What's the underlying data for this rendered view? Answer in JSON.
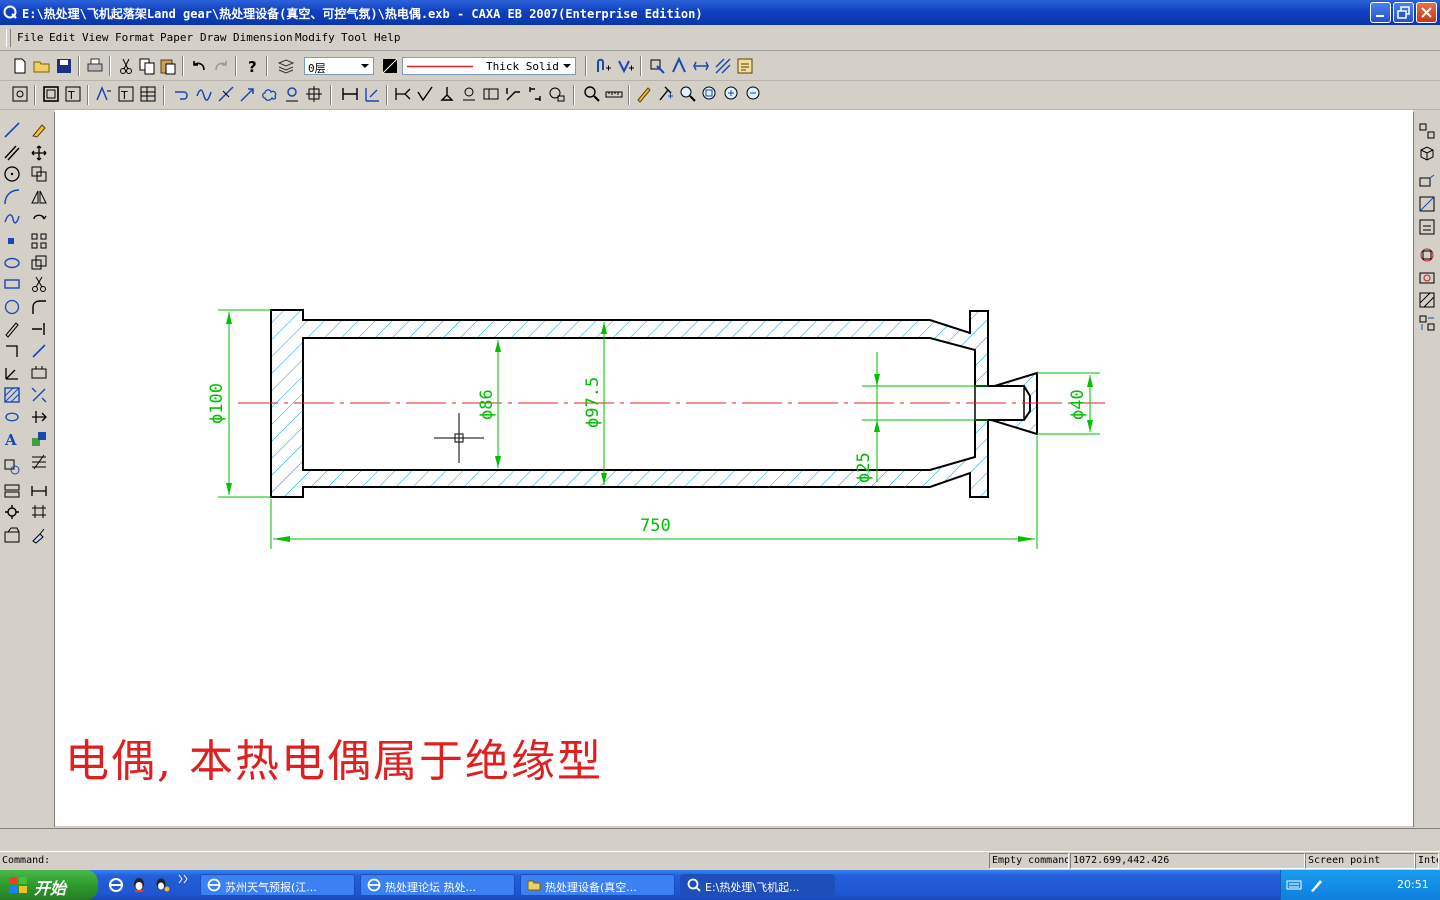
{
  "window": {
    "title": "E:\\热处理\\飞机起落架Land gear\\热处理设备(真空、可控气氛)\\热电偶.exb - CAXA EB 2007(Enterprise Edition)",
    "buttons": [
      "minimize",
      "restore",
      "close"
    ]
  },
  "menu": {
    "items": [
      "File",
      "Edit",
      "View",
      "Format",
      "Paper",
      "Draw",
      "Dimension",
      "Modify",
      "Tool",
      "Help"
    ]
  },
  "toolbar": {
    "layer_value": "0层",
    "linetype_value": "Thick Solid",
    "line_color": "#e02020"
  },
  "drawing": {
    "dimensions": {
      "d100": "ϕ100",
      "d86": "ϕ86",
      "d97_5": "ϕ97.5",
      "d25": "ϕ25",
      "d40": "ϕ40",
      "length": "750"
    },
    "caption": "电偶,  本热电偶属于绝缘型",
    "colors": {
      "outline": "#000000",
      "hatch": "#00a0e0",
      "dimension": "#00c000",
      "centerline": "#e02020"
    }
  },
  "command": {
    "label": "Command:"
  },
  "status": {
    "mode": "Empty command",
    "coords": "1072.699,442.426",
    "snap": "Screen point",
    "snap_value": "Intel"
  },
  "taskbar": {
    "start_label": "开始",
    "tasks": [
      {
        "label": "苏州天气预报(江...",
        "icon": "ie-icon"
      },
      {
        "label": "热处理论坛 热处...",
        "icon": "ie-icon"
      },
      {
        "label": "热处理设备(真空...",
        "icon": "folder-icon"
      },
      {
        "label": "E:\\热处理\\飞机起...",
        "icon": "caxa-icon"
      }
    ],
    "clock": "20:51"
  }
}
